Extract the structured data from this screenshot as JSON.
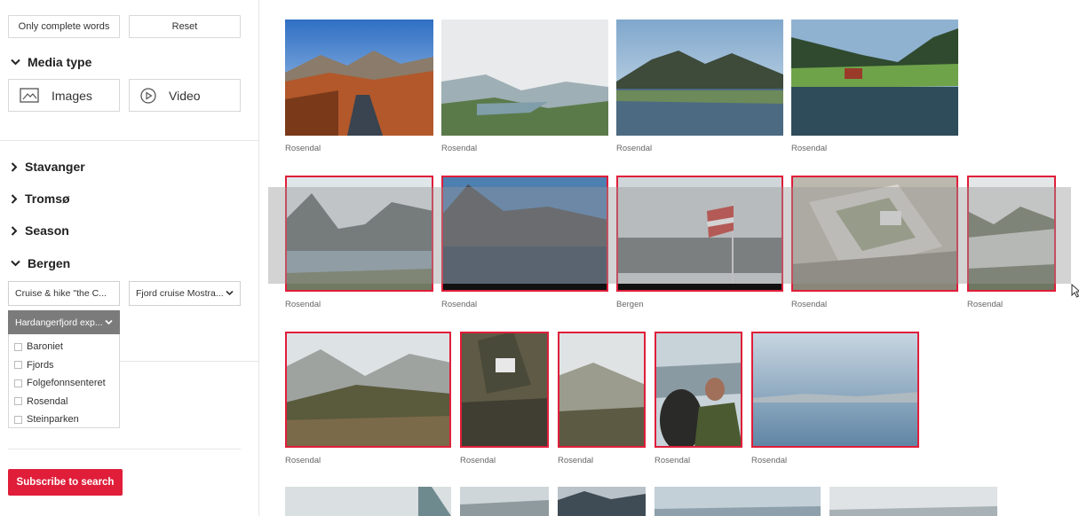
{
  "filters": {
    "only_complete_words": "Only complete words",
    "reset": "Reset"
  },
  "media_type": {
    "title": "Media type",
    "images": "Images",
    "video": "Video"
  },
  "sections": {
    "stavanger": "Stavanger",
    "tromso": "Tromsø",
    "season": "Season",
    "bergen": "Bergen"
  },
  "bergen": {
    "dropdown1": "Cruise & hike \"the C...",
    "dropdown2": "Fjord cruise Mostra...",
    "dropdown3": "Hardangerfjord exp...",
    "options": [
      "Baroniet",
      "Fjords",
      "Folgefonnsenteret",
      "Rosendal",
      "Steinparken"
    ]
  },
  "subscribe": "Subscribe to search",
  "gallery": {
    "row1": [
      "Rosendal",
      "Rosendal",
      "Rosendal",
      "Rosendal"
    ],
    "row2": [
      "Rosendal",
      "Rosendal",
      "Bergen",
      "Rosendal",
      "Rosendal"
    ],
    "row3": [
      "Rosendal",
      "Rosendal",
      "Rosendal",
      "Rosendal",
      "Rosendal"
    ]
  },
  "colors": {
    "accent": "#e01e3a",
    "selected_border": "#e01e3a",
    "active_dropdown": "#7b7b7b"
  }
}
